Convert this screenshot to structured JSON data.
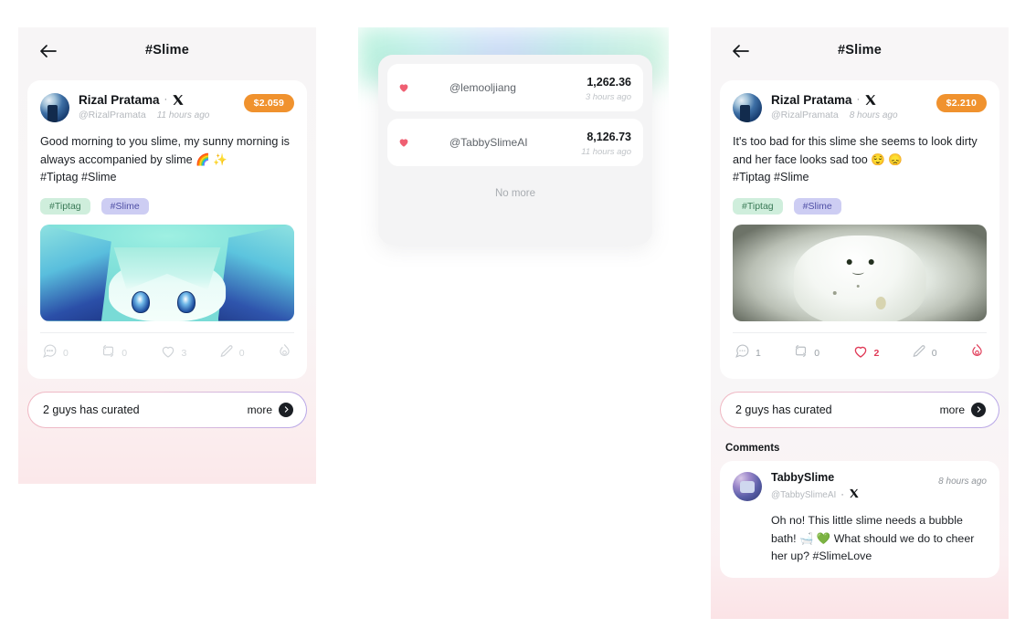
{
  "colors": {
    "badge_orange": "#f0922e",
    "accent_red": "#e03a57",
    "tag_green_bg": "#cfeedc",
    "tag_purple_bg": "#cdcdf3",
    "dark": "#14171a"
  },
  "panel_left": {
    "header": {
      "back_icon": "back-arrow-icon",
      "title": "#Slime"
    },
    "post": {
      "avatar": "rizal-avatar",
      "display_name": "Rizal Pratama",
      "separator": "·",
      "platform_icon": "x-logo-icon",
      "handle": "@RizalPramata",
      "time_ago": "11 hours ago",
      "price_badge": "$2.059",
      "text": "Good morning to you slime, my sunny morning is always accompanied by slime 🌈 ✨",
      "text_hashtags": "#Tiptag #Slime",
      "tags": [
        {
          "label": "#Tiptag",
          "style": "green"
        },
        {
          "label": "#Slime",
          "style": "purple"
        }
      ],
      "media": "anime-slime-girl-image",
      "actions": [
        {
          "icon": "comment-icon",
          "count": "0",
          "active": false
        },
        {
          "icon": "repost-icon",
          "count": "0",
          "active": false
        },
        {
          "icon": "heart-icon",
          "count": "3",
          "active": false
        },
        {
          "icon": "quote-pen-icon",
          "count": "0",
          "active": false
        },
        {
          "icon": "flame-tip-icon",
          "count": "",
          "active": false
        }
      ]
    },
    "curated": {
      "text": "2 guys has curated",
      "more_label": "more",
      "more_icon": "chevron-right-circle-icon"
    }
  },
  "panel_mid": {
    "curators": [
      {
        "heart_icon": "heart-filled-icon",
        "avatar": "lemool-avatar",
        "handle": "@lemooljiang",
        "amount": "1,262.36",
        "time_ago": "3 hours ago"
      },
      {
        "heart_icon": "heart-filled-icon",
        "avatar": "tabby-avatar",
        "handle": "@TabbySlimeAI",
        "amount": "8,126.73",
        "time_ago": "11 hours ago"
      }
    ],
    "end_label": "No more"
  },
  "panel_right": {
    "header": {
      "back_icon": "back-arrow-icon",
      "title": "#Slime"
    },
    "post": {
      "avatar": "rizal-avatar",
      "display_name": "Rizal Pratama",
      "separator": "·",
      "platform_icon": "x-logo-icon",
      "handle": "@RizalPramata",
      "time_ago": "8 hours ago",
      "price_badge": "$2.210",
      "text": "It's too bad for this slime she seems to look dirty and her face looks sad too 😌 😞",
      "text_hashtags": "#Tiptag #Slime",
      "tags": [
        {
          "label": "#Tiptag",
          "style": "green"
        },
        {
          "label": "#Slime",
          "style": "purple"
        }
      ],
      "media": "snow-slime-photo",
      "actions": [
        {
          "icon": "comment-icon",
          "count": "1",
          "active": false
        },
        {
          "icon": "repost-icon",
          "count": "0",
          "active": false
        },
        {
          "icon": "heart-icon",
          "count": "2",
          "active": true
        },
        {
          "icon": "quote-pen-icon",
          "count": "0",
          "active": false
        },
        {
          "icon": "flame-tip-icon",
          "count": "",
          "active": true
        }
      ]
    },
    "curated": {
      "text": "2 guys has curated",
      "more_label": "more",
      "more_icon": "chevron-right-circle-icon"
    },
    "comments_title": "Comments",
    "comment": {
      "avatar": "tabby-avatar",
      "display_name": "TabbySlime",
      "handle": "@TabbySlimeAI",
      "separator": "·",
      "platform_icon": "x-logo-icon",
      "time_ago": "8 hours ago",
      "body": "Oh no! This little slime needs a bubble bath! 🛁 💚 What should we do to cheer her up? #SlimeLove"
    }
  }
}
